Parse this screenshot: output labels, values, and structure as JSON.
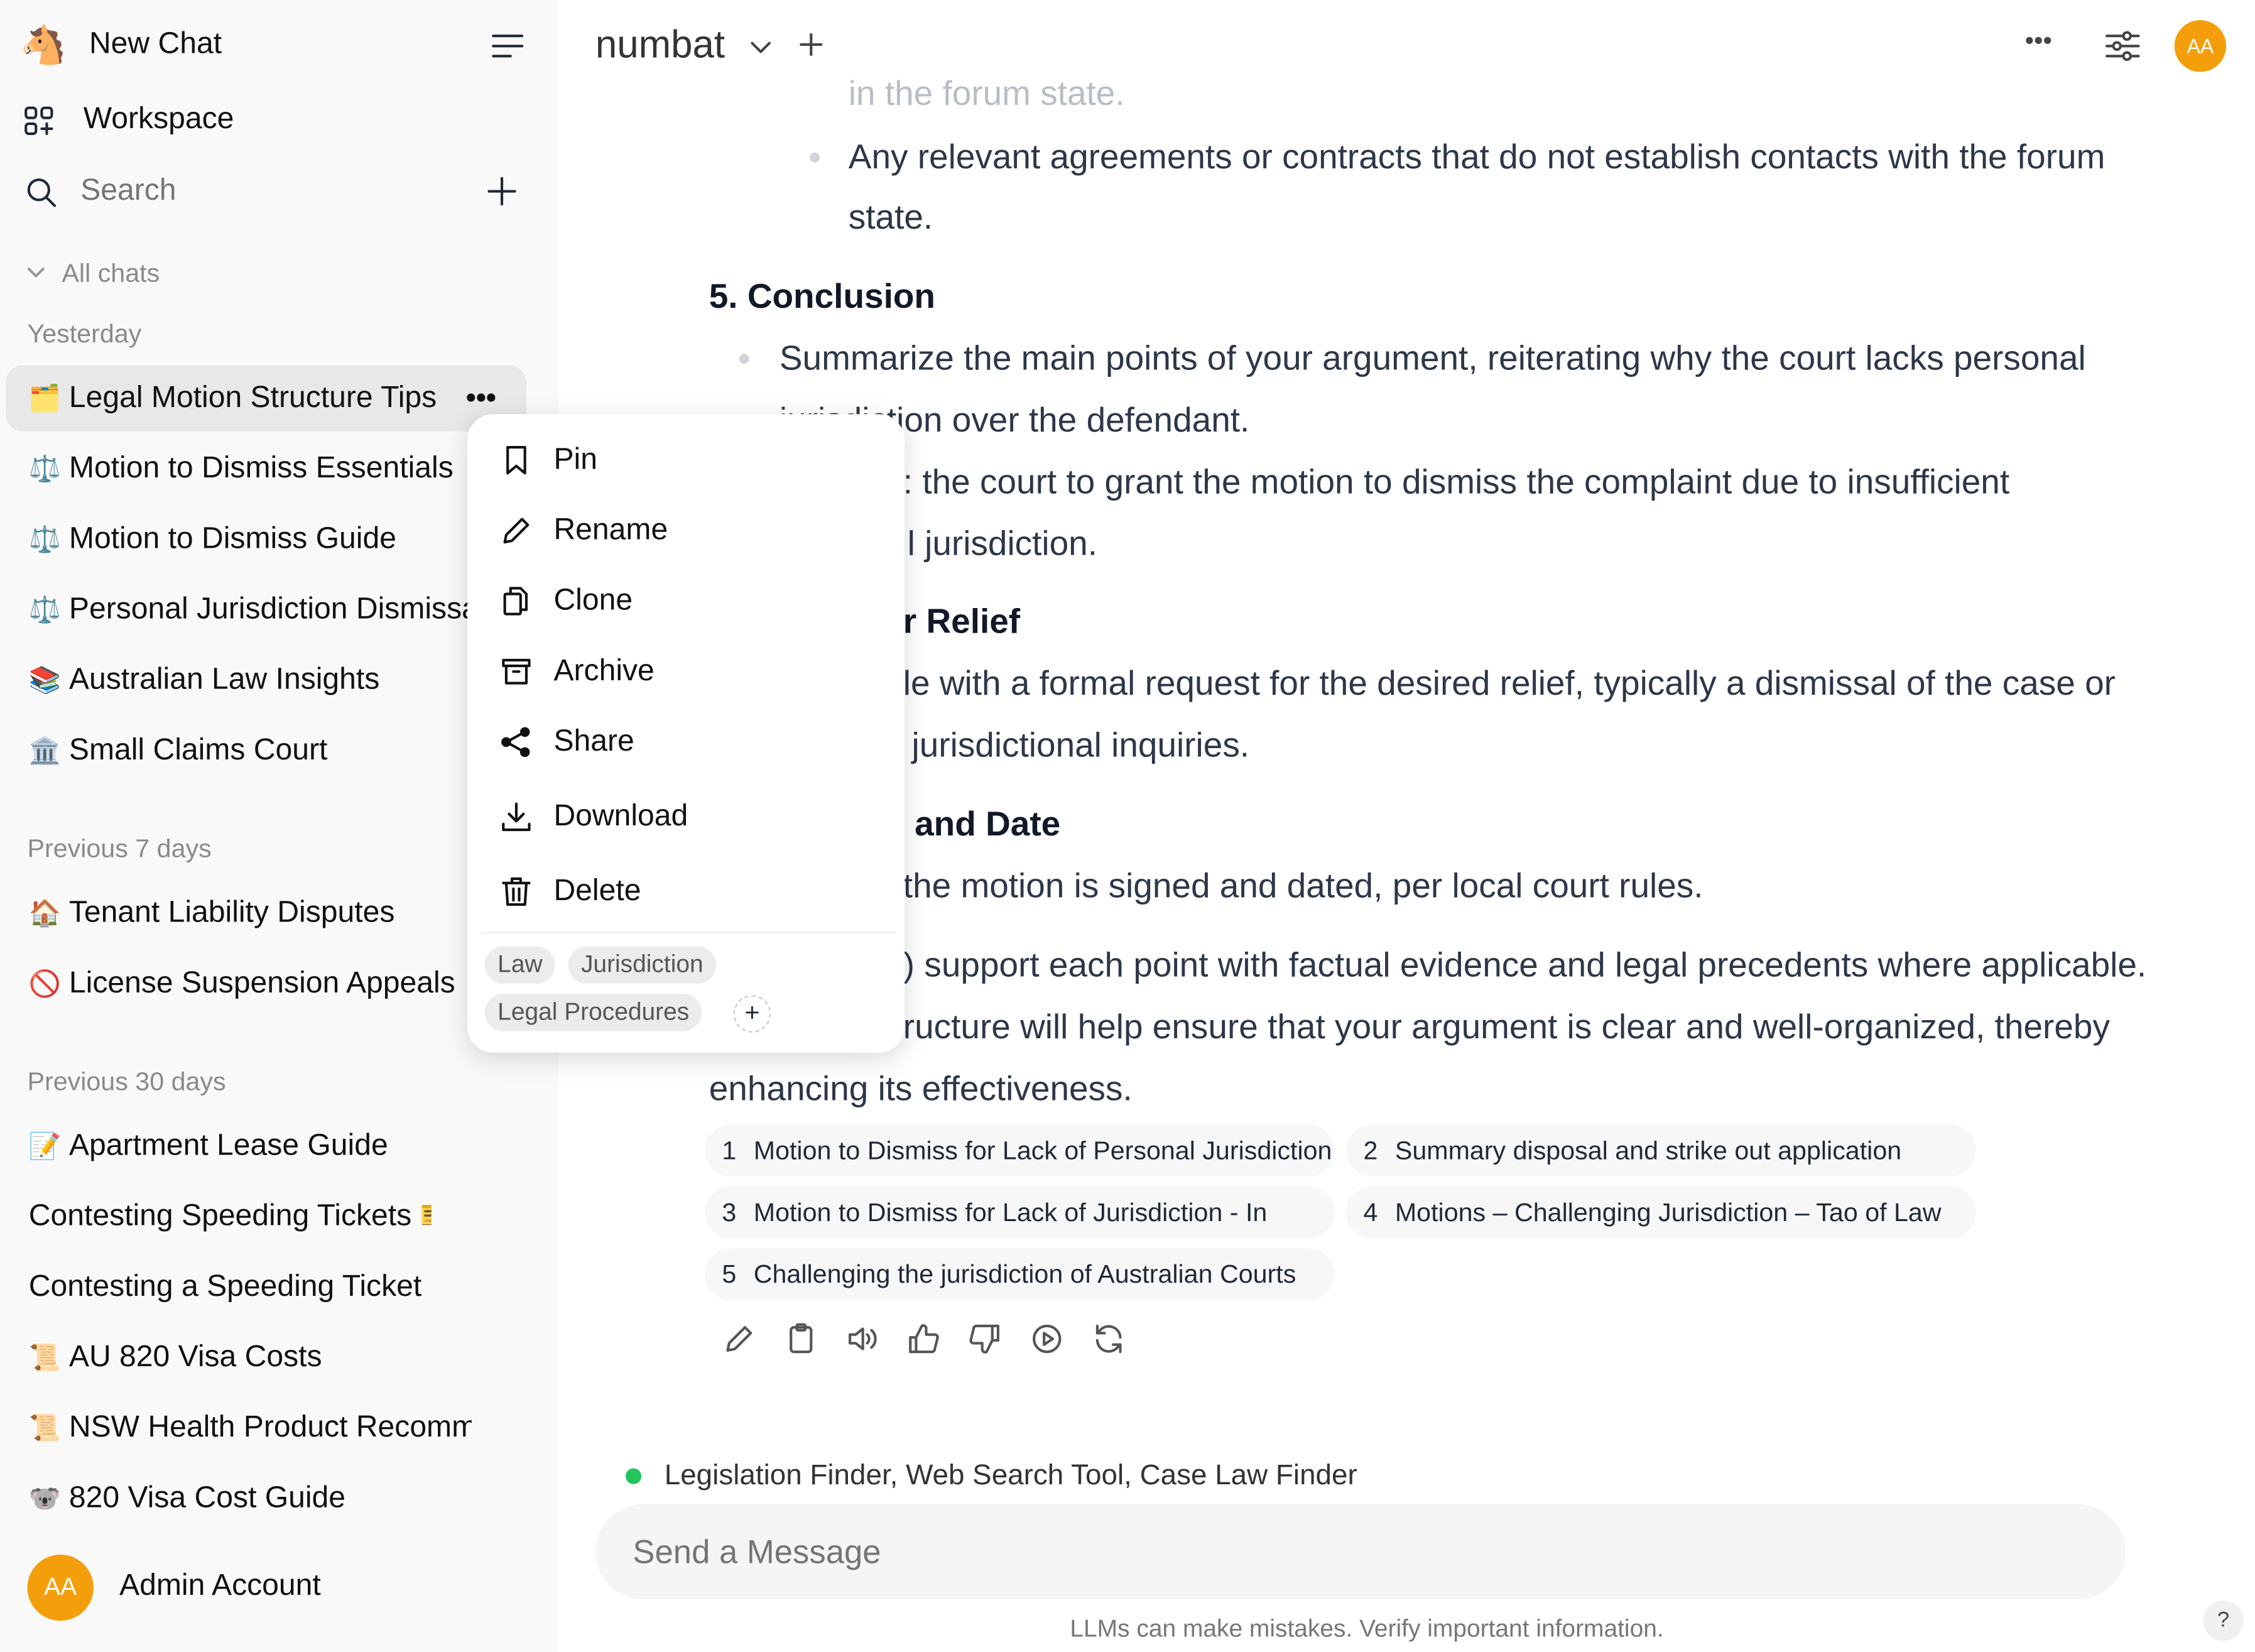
{
  "sidebar": {
    "new_chat": "New Chat",
    "workspace": "Workspace",
    "search_placeholder": "Search",
    "all_chats": "All chats",
    "sections": [
      {
        "label": "Yesterday",
        "items": [
          {
            "emoji": "🗂️",
            "label": "Legal Motion Structure Tips"
          },
          {
            "emoji": "⚖️",
            "label": "Motion to Dismiss Essentials"
          },
          {
            "emoji": "⚖️",
            "label": "Motion to Dismiss Guide"
          },
          {
            "emoji": "⚖️",
            "label": "Personal Jurisdiction Dismissal"
          },
          {
            "emoji": "📚",
            "label": "Australian Law Insights"
          },
          {
            "emoji": "🏛️",
            "label": "Small Claims Court"
          }
        ]
      },
      {
        "label": "Previous 7 days",
        "items": [
          {
            "emoji": "🏠",
            "label": "Tenant Liability Disputes"
          },
          {
            "emoji": "🚫",
            "label": "License Suspension Appeals"
          }
        ]
      },
      {
        "label": "Previous 30 days",
        "items": [
          {
            "emoji": "📝",
            "label": "Apartment Lease Guide"
          },
          {
            "emoji": "",
            "label": "Contesting Speeding Tickets 🎫"
          },
          {
            "emoji": "",
            "label": "Contesting a Speeding Ticket"
          },
          {
            "emoji": "📜",
            "label": "AU 820 Visa Costs"
          },
          {
            "emoji": "📜",
            "label": "NSW Health Product Recommendations"
          },
          {
            "emoji": "🐨",
            "label": "820 Visa Cost Guide"
          }
        ]
      }
    ],
    "user": {
      "initials": "AA",
      "name": "Admin Account"
    }
  },
  "context_menu": {
    "items": [
      "Pin",
      "Rename",
      "Clone",
      "Archive",
      "Share",
      "Download",
      "Delete"
    ],
    "tags": [
      "Law",
      "Jurisdiction",
      "Legal Procedures"
    ]
  },
  "header": {
    "model": "numbat",
    "avatar": "AA"
  },
  "message": {
    "lines": [
      "in the forum state.",
      "Any relevant agreements or contracts that do not establish contacts with the forum",
      "state.",
      "5. Conclusion",
      "Summarize the main points of your argument, reiterating why the court lacks personal",
      "jurisdiction over the defendant.",
      ": the court to grant the motion to dismiss the complaint due to insufficient",
      "l jurisdiction.",
      "r Relief",
      "le with a formal request for the desired relief, typically a dismissal of the case or",
      "jurisdictional inquiries.",
      "and Date",
      "the motion is signed and dated, per local court rules.",
      ") support each point with factual evidence and legal precedents where applicable.",
      "ructure will help ensure that your argument is clear and well-organized, thereby",
      "enhancing its effectiveness."
    ],
    "citations": [
      {
        "n": "1",
        "title": "Motion to Dismiss for Lack of Personal Jurisdiction"
      },
      {
        "n": "2",
        "title": "Summary disposal and strike out application"
      },
      {
        "n": "3",
        "title": "Motion to Dismiss for Lack of Jurisdiction - In"
      },
      {
        "n": "4",
        "title": "Motions – Challenging Jurisdiction – Tao of Law"
      },
      {
        "n": "5",
        "title": "Challenging the jurisdiction of Australian Courts"
      }
    ]
  },
  "tools": {
    "label": "Legislation Finder, Web Search Tool, Case Law Finder",
    "status_color": "#22c55e"
  },
  "input": {
    "placeholder": "Send a Message"
  },
  "footer": {
    "disclaimer": "LLMs can make mistakes. Verify important information.",
    "help": "?"
  },
  "colors": {
    "avatar": "#f59e0b",
    "sidebar_bg": "#f9f9f9"
  }
}
